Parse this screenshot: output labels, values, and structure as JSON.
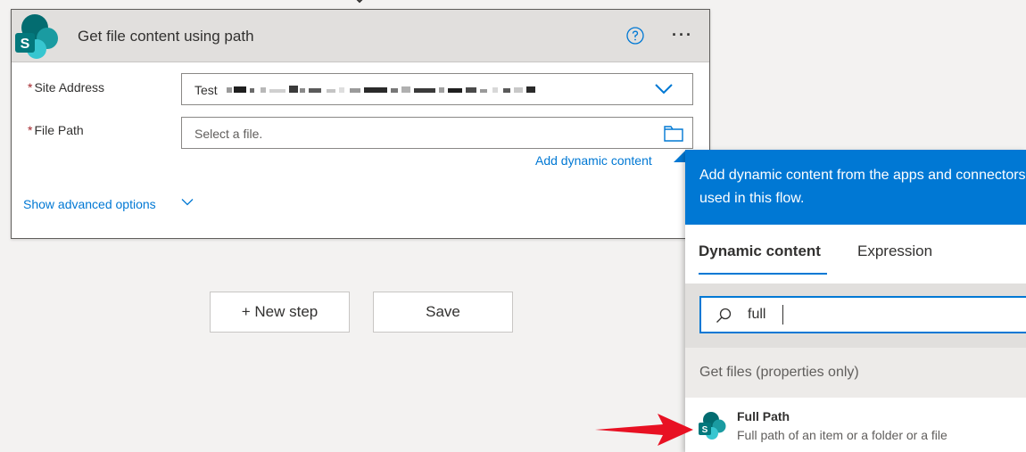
{
  "action_card": {
    "title": "Get file content using path",
    "fields": [
      {
        "required_mark": "*",
        "label": "Site Address",
        "value": "Test"
      },
      {
        "required_mark": "*",
        "label": "File Path",
        "placeholder": "Select a file."
      }
    ],
    "add_dynamic_content": "Add dynamic content",
    "show_advanced": "Show advanced options"
  },
  "buttons": {
    "new_step": "+ New step",
    "save": "Save"
  },
  "dynamic_panel": {
    "header": "Add dynamic content from the apps and connectors used in this flow.",
    "tabs": [
      "Dynamic content",
      "Expression"
    ],
    "search_value": "full",
    "group": "Get files (properties only)",
    "result": {
      "title": "Full Path",
      "description": "Full path of an item or a folder or a file"
    }
  },
  "colors": {
    "accent": "#0078d4",
    "required": "#a4262c",
    "arrow": "#e81123"
  }
}
